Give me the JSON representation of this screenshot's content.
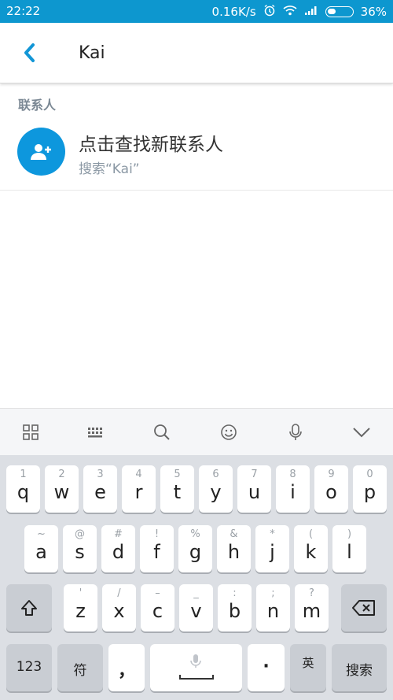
{
  "status_bar": {
    "time": "22:22",
    "network_speed": "0.16K/s",
    "battery_percent": "36%",
    "battery_level": 0.36
  },
  "header": {
    "search_value": "Kai",
    "back_icon": "chevron-left-icon"
  },
  "contacts": {
    "section_label": "联系人",
    "find_new": {
      "title": "点击查找新联系人",
      "subtitle": "搜索“Kai”",
      "icon": "add-person-icon"
    }
  },
  "keyboard": {
    "toolbar": [
      "grid-icon",
      "keyboard-icon",
      "search-icon",
      "emoji-icon",
      "microphone-icon",
      "chevron-down-icon"
    ],
    "row1": [
      {
        "hint": "1",
        "key": "q"
      },
      {
        "hint": "2",
        "key": "w"
      },
      {
        "hint": "3",
        "key": "e"
      },
      {
        "hint": "4",
        "key": "r"
      },
      {
        "hint": "5",
        "key": "t"
      },
      {
        "hint": "6",
        "key": "y"
      },
      {
        "hint": "7",
        "key": "u"
      },
      {
        "hint": "8",
        "key": "i"
      },
      {
        "hint": "9",
        "key": "o"
      },
      {
        "hint": "0",
        "key": "p"
      }
    ],
    "row2": [
      {
        "hint": "~",
        "key": "a"
      },
      {
        "hint": "@",
        "key": "s"
      },
      {
        "hint": "#",
        "key": "d"
      },
      {
        "hint": "!",
        "key": "f"
      },
      {
        "hint": "%",
        "key": "g"
      },
      {
        "hint": "&",
        "key": "h"
      },
      {
        "hint": "*",
        "key": "j"
      },
      {
        "hint": "(",
        "key": "k"
      },
      {
        "hint": ")",
        "key": "l"
      }
    ],
    "row3": [
      {
        "hint": "'",
        "key": "z"
      },
      {
        "hint": "/",
        "key": "x"
      },
      {
        "hint": "–",
        "key": "c"
      },
      {
        "hint": "_",
        "key": "v"
      },
      {
        "hint": ":",
        "key": "b"
      },
      {
        "hint": ";",
        "key": "n"
      },
      {
        "hint": "?",
        "key": "m"
      }
    ],
    "bottom": {
      "numbers_label": "123",
      "symbols_label": "符",
      "comma_label": "，",
      "period_label": "·",
      "lang_label": "英",
      "search_label": "搜索"
    }
  }
}
